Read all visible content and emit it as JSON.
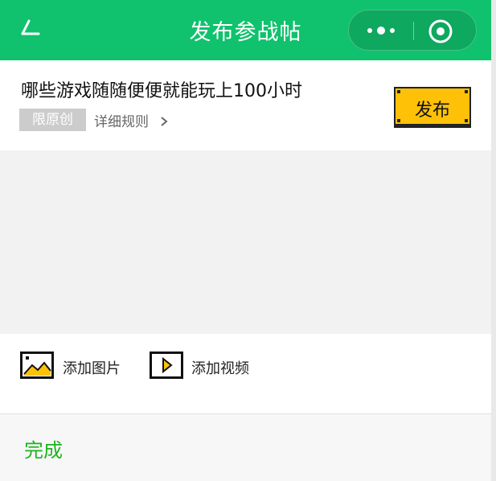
{
  "header": {
    "title": "发布参战帖",
    "back_icon": "back-arrow-icon",
    "more_icon": "more-dots-icon",
    "close_icon": "target-close-icon",
    "color": "#10c26d"
  },
  "post": {
    "title": "哪些游戏随随便便就能玩上100小时",
    "badge": "限原创",
    "rules_link": "详细规则"
  },
  "publish_button": {
    "label": "发布",
    "color": "#ffc107"
  },
  "editor": {
    "text": ""
  },
  "media": {
    "add_image_label": "添加图片",
    "add_video_label": "添加视频",
    "image_icon": "image-icon",
    "video_icon": "video-play-icon"
  },
  "footer": {
    "done_label": "完成",
    "done_color": "#1db31d"
  }
}
